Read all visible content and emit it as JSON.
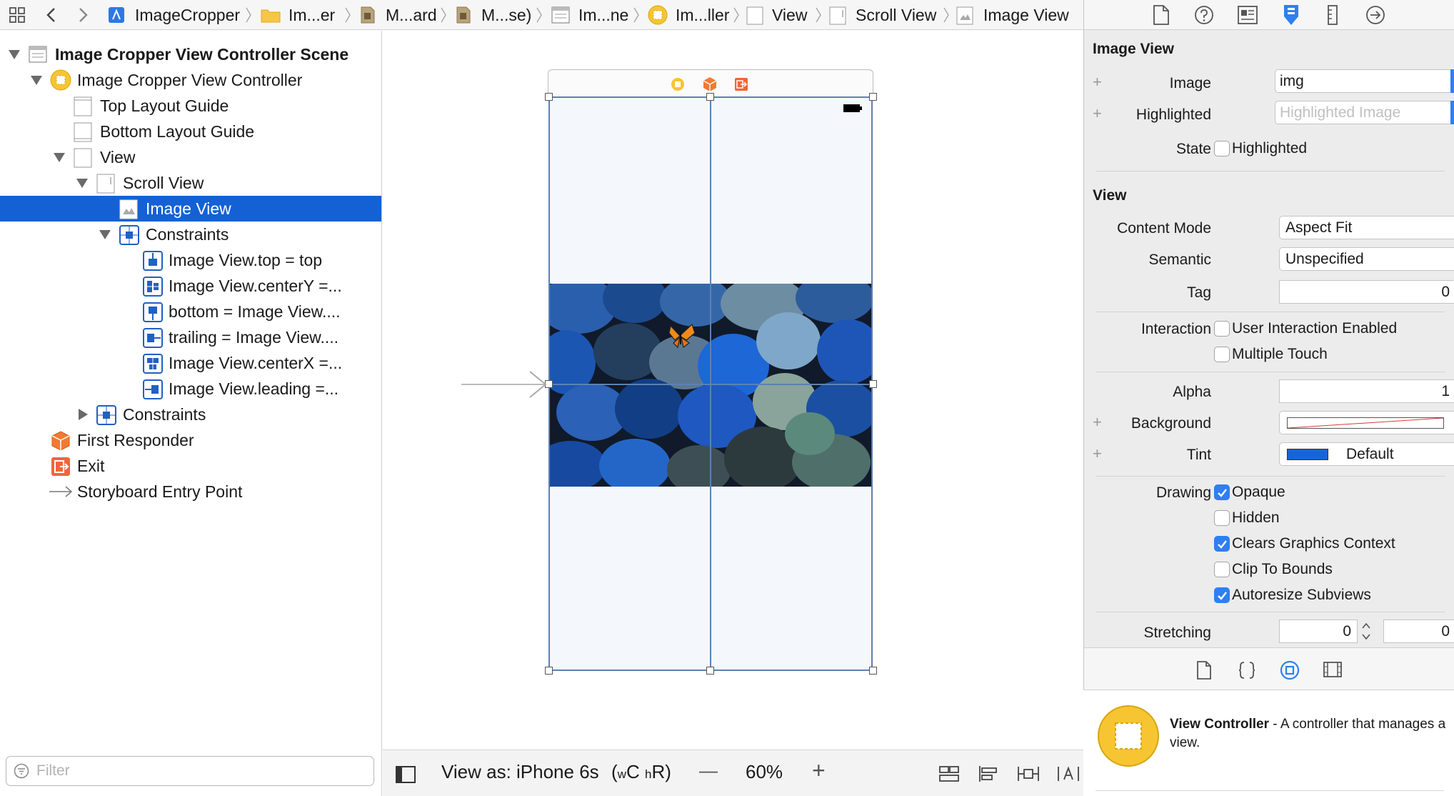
{
  "jumpbar": {
    "crumbs": [
      "ImageCropper",
      "Im...er",
      "M...ard",
      "M...se)",
      "Im...ne",
      "Im...ller",
      "View",
      "Scroll View",
      "Image View"
    ]
  },
  "navigator": {
    "rows": [
      {
        "label": "Image Cropper View Controller Scene",
        "icon": "scene-icon"
      },
      {
        "label": "Image Cropper View Controller",
        "icon": "view-controller-icon"
      },
      {
        "label": "Top Layout Guide",
        "icon": "layout-guide-icon"
      },
      {
        "label": "Bottom Layout Guide",
        "icon": "layout-guide-icon"
      },
      {
        "label": "View",
        "icon": "view-icon"
      },
      {
        "label": "Scroll View",
        "icon": "scroll-view-icon"
      },
      {
        "label": "Image View",
        "icon": "image-view-icon"
      },
      {
        "label": "Constraints",
        "icon": "constraints-icon"
      },
      {
        "label": "Image View.top = top",
        "icon": "constraint-icon"
      },
      {
        "label": "Image View.centerY =...",
        "icon": "constraint-icon"
      },
      {
        "label": "bottom = Image View....",
        "icon": "constraint-icon"
      },
      {
        "label": "trailing = Image View....",
        "icon": "constraint-icon"
      },
      {
        "label": "Image View.centerX =...",
        "icon": "constraint-icon"
      },
      {
        "label": "Image View.leading =...",
        "icon": "constraint-icon"
      },
      {
        "label": "Constraints",
        "icon": "constraints-icon"
      },
      {
        "label": "First Responder",
        "icon": "first-responder-icon"
      },
      {
        "label": "Exit",
        "icon": "exit-icon"
      },
      {
        "label": "Storyboard Entry Point",
        "icon": "entry-arrow-icon"
      }
    ],
    "filter_placeholder": "Filter"
  },
  "bottombar": {
    "view_as": "View as: iPhone 6s",
    "size_class_w": "w",
    "size_class_w_value": "C",
    "size_class_h": "h",
    "size_class_h_value": "R",
    "zoom": "60%",
    "zoom_out": "—",
    "zoom_in": "+"
  },
  "inspector": {
    "tabs": [
      "file-icon",
      "help-icon",
      "identity-icon",
      "attributes-icon",
      "size-icon",
      "connections-icon"
    ],
    "image_view": {
      "title": "Image View",
      "image_label": "Image",
      "image_value": "img",
      "highlighted_label": "Highlighted",
      "highlighted_placeholder": "Highlighted Image",
      "state_label": "State",
      "state_checkbox": "Highlighted"
    },
    "view": {
      "title": "View",
      "content_mode_label": "Content Mode",
      "content_mode_value": "Aspect Fit",
      "semantic_label": "Semantic",
      "semantic_value": "Unspecified",
      "tag_label": "Tag",
      "tag_value": "0",
      "interaction_label": "Interaction",
      "user_interaction": "User Interaction Enabled",
      "multiple_touch": "Multiple Touch",
      "alpha_label": "Alpha",
      "alpha_value": "1",
      "background_label": "Background",
      "tint_label": "Tint",
      "tint_value": "Default",
      "drawing_label": "Drawing",
      "opaque": "Opaque",
      "hidden": "Hidden",
      "clears_graphics": "Clears Graphics Context",
      "clip_to_bounds": "Clip To Bounds",
      "autoresize": "Autoresize Subviews",
      "stretching_label": "Stretching",
      "stretch_x": "0",
      "stretch_y": "0"
    },
    "checkbox_states": {
      "state_highlighted": false,
      "user_interaction": false,
      "multiple_touch": false,
      "opaque": true,
      "hidden": false,
      "clears_graphics": true,
      "clip_to_bounds": false,
      "autoresize": true
    },
    "colors": {
      "accent": "#2f7ff0",
      "tint_swatch": "#1565d8",
      "selection": "#1461d6",
      "vc_yellow": "#f7c531"
    },
    "library_tabs": [
      "file-template-icon",
      "code-snippet-icon",
      "object-library-icon",
      "media-library-icon"
    ],
    "library_item": {
      "title": "View Controller",
      "description": " - A controller that manages a view."
    }
  }
}
